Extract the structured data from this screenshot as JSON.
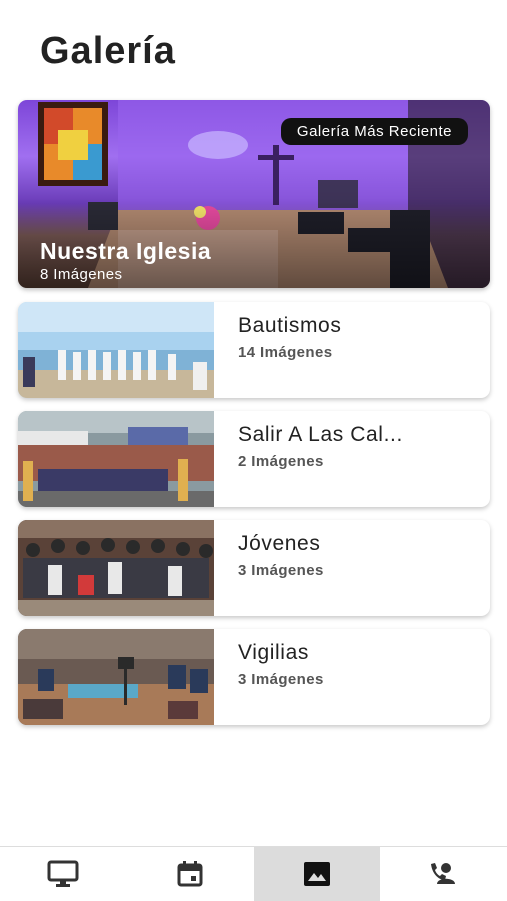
{
  "header": {
    "title": "Galería"
  },
  "featured": {
    "badge": "Galería Más Reciente",
    "title": "Nuestra Iglesia",
    "count": "8 Imágenes"
  },
  "albums": [
    {
      "title": "Bautismos",
      "count": "14 Imágenes"
    },
    {
      "title": "Salir A Las Cal...",
      "count": "2 Imágenes"
    },
    {
      "title": "Jóvenes",
      "count": "3 Imágenes"
    },
    {
      "title": "Vigilias",
      "count": "3 Imágenes"
    }
  ],
  "bottom_nav": {
    "items": [
      {
        "icon": "monitor-icon",
        "active": false
      },
      {
        "icon": "calendar-icon",
        "active": false
      },
      {
        "icon": "image-icon",
        "active": true
      },
      {
        "icon": "contact-phone-icon",
        "active": false
      }
    ]
  },
  "colors": {
    "accent_purple": "#8a4fe6",
    "active_tab_bg": "#dcdcdc",
    "badge_bg": "#111111"
  }
}
